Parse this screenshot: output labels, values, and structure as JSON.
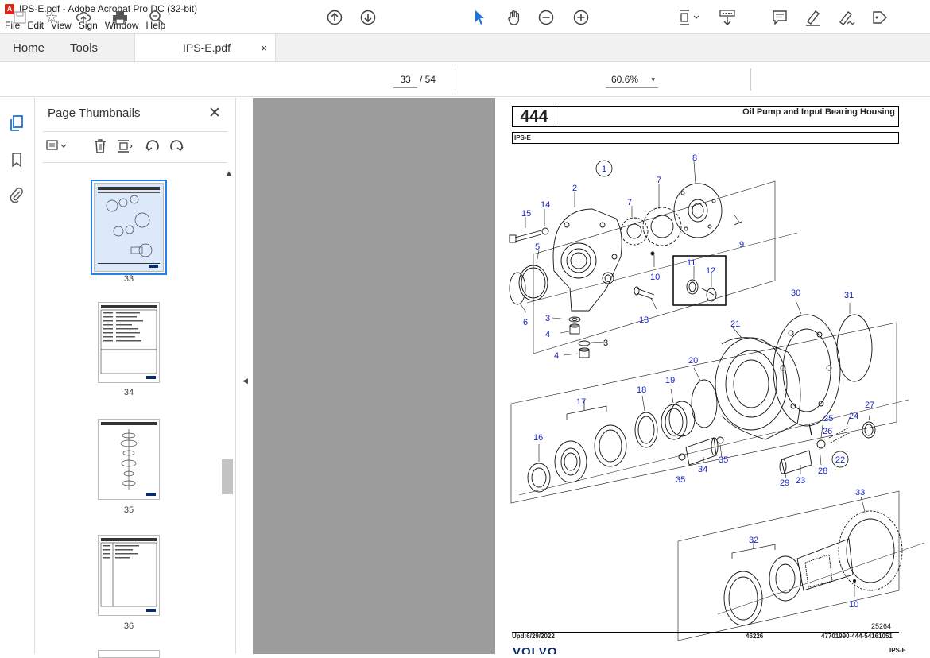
{
  "window": {
    "title": "IPS-E.pdf - Adobe Acrobat Pro DC (32-bit)",
    "app_icon": "pdf-icon"
  },
  "menu": [
    "File",
    "Edit",
    "View",
    "Sign",
    "Window",
    "Help"
  ],
  "tabs": {
    "home": "Home",
    "tools": "Tools",
    "document": "IPS-E.pdf",
    "close": "×"
  },
  "toolbar": {
    "current_page": "33",
    "total_pages": "/ 54",
    "zoom": "60.6%",
    "zoom_caret": "▾"
  },
  "sidebar": {
    "title": "Page Thumbnails",
    "close": "✕"
  },
  "thumbnails": [
    {
      "page": "33",
      "selected": true
    },
    {
      "page": "34",
      "selected": false
    },
    {
      "page": "35",
      "selected": false
    },
    {
      "page": "36",
      "selected": false
    }
  ],
  "document": {
    "section_number": "444",
    "section_title": "Oil Pump and Input Bearing Housing",
    "model": "IPS-E",
    "callouts": [
      "1",
      "2",
      "3",
      "3",
      "4",
      "4",
      "5",
      "6",
      "7",
      "7",
      "8",
      "9",
      "10",
      "10",
      "11",
      "12",
      "13",
      "14",
      "15",
      "16",
      "17",
      "18",
      "19",
      "20",
      "21",
      "22",
      "23",
      "24",
      "25",
      "26",
      "27",
      "28",
      "29",
      "30",
      "31",
      "32",
      "33",
      "34",
      "35",
      "35"
    ],
    "figure_number": "25264",
    "footer_date": "Upd:6/29/2022",
    "footer_code": "46226",
    "footer_ref": "47701990-444-54161051",
    "brand": "VOLVO",
    "brand_model": "IPS-E"
  },
  "colors": {
    "callout": "#1a25c9",
    "viewer_bg": "#9c9c9c",
    "selection": "#2680eb"
  }
}
